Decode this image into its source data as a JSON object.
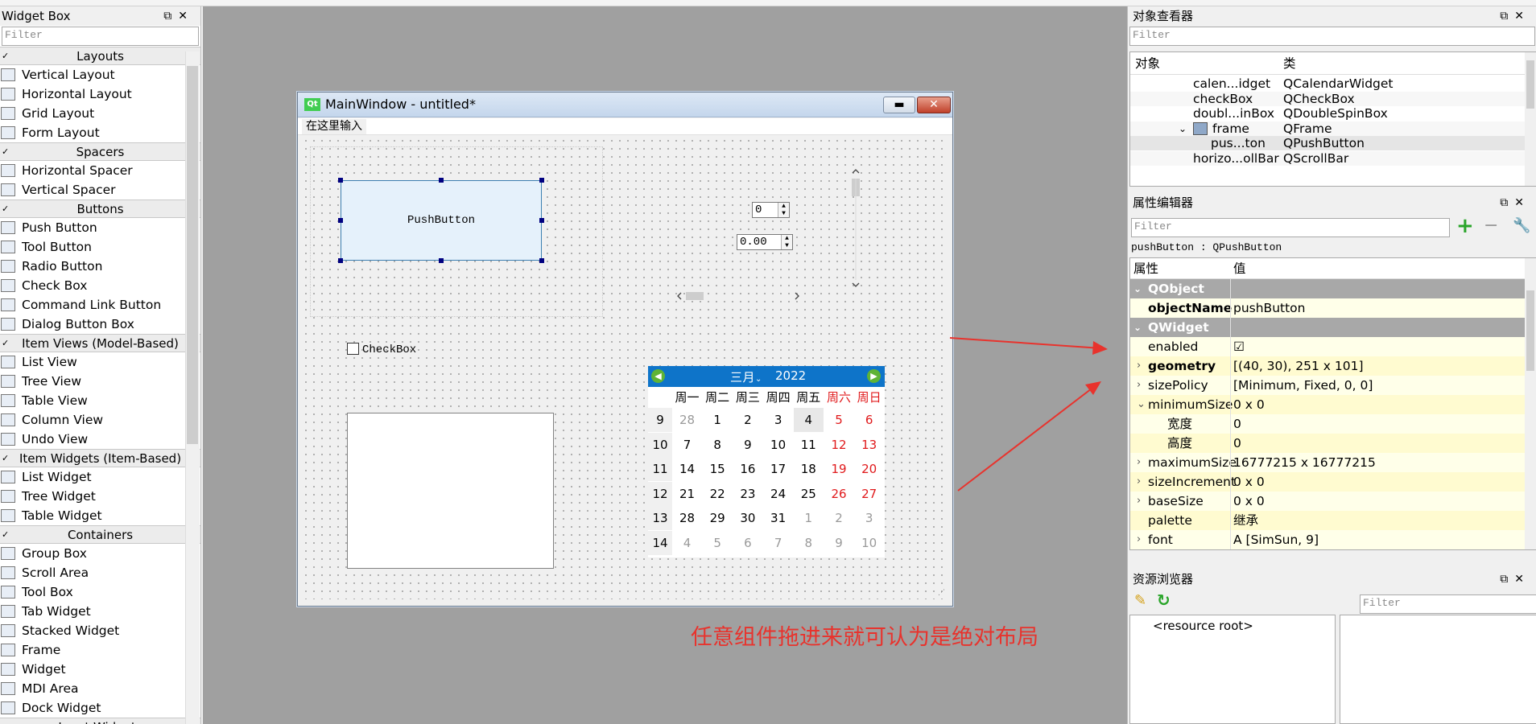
{
  "widget_box": {
    "title": "Widget Box",
    "filter_placeholder": "Filter",
    "categories": [
      {
        "label": "Layouts",
        "items": [
          "Vertical Layout",
          "Horizontal Layout",
          "Grid Layout",
          "Form Layout"
        ]
      },
      {
        "label": "Spacers",
        "items": [
          "Horizontal Spacer",
          "Vertical Spacer"
        ]
      },
      {
        "label": "Buttons",
        "items": [
          "Push Button",
          "Tool Button",
          "Radio Button",
          "Check Box",
          "Command Link Button",
          "Dialog Button Box"
        ]
      },
      {
        "label": "Item Views (Model-Based)",
        "items": [
          "List View",
          "Tree View",
          "Table View",
          "Column View",
          "Undo View"
        ]
      },
      {
        "label": "Item Widgets (Item-Based)",
        "items": [
          "List Widget",
          "Tree Widget",
          "Table Widget"
        ]
      },
      {
        "label": "Containers",
        "items": [
          "Group Box",
          "Scroll Area",
          "Tool Box",
          "Tab Widget",
          "Stacked Widget",
          "Frame",
          "Widget",
          "MDI Area",
          "Dock Widget"
        ]
      }
    ],
    "partial_last": "Input Widgets"
  },
  "main_window": {
    "title": "MainWindow - untitled*",
    "logo": "Qt",
    "menu_placeholder": "在这里输入",
    "push_button_label": "PushButton",
    "checkbox_label": "CheckBox",
    "spin_value": "0",
    "double_spin_value": "0.00"
  },
  "calendar": {
    "month": "三月",
    "year": "2022",
    "weekdays": [
      "周一",
      "周二",
      "周三",
      "周四",
      "周五",
      "周六",
      "周日"
    ],
    "weeks": [
      {
        "wk": "9",
        "days": [
          "28",
          "1",
          "2",
          "3",
          "4",
          "5",
          "6"
        ]
      },
      {
        "wk": "10",
        "days": [
          "7",
          "8",
          "9",
          "10",
          "11",
          "12",
          "13"
        ]
      },
      {
        "wk": "11",
        "days": [
          "14",
          "15",
          "16",
          "17",
          "18",
          "19",
          "20"
        ]
      },
      {
        "wk": "12",
        "days": [
          "21",
          "22",
          "23",
          "24",
          "25",
          "26",
          "27"
        ]
      },
      {
        "wk": "13",
        "days": [
          "28",
          "29",
          "30",
          "31",
          "1",
          "2",
          "3"
        ]
      },
      {
        "wk": "14",
        "days": [
          "4",
          "5",
          "6",
          "7",
          "8",
          "9",
          "10"
        ]
      }
    ],
    "weekend_color": "#e0191b",
    "header_color": "#0e74c9"
  },
  "object_inspector": {
    "title": "对象查看器",
    "filter_placeholder": "Filter",
    "col_object": "对象",
    "col_class": "类",
    "rows": [
      {
        "name": "calen...idget",
        "cls": "QCalendarWidget"
      },
      {
        "name": "checkBox",
        "cls": "QCheckBox"
      },
      {
        "name": "doubl...inBox",
        "cls": "QDoubleSpinBox"
      },
      {
        "name": "frame",
        "cls": "QFrame"
      },
      {
        "name": "pus...ton",
        "cls": "QPushButton"
      },
      {
        "name": "horizo...ollBar",
        "cls": "QScrollBar"
      }
    ]
  },
  "property_editor": {
    "title": "属性编辑器",
    "filter_placeholder": "Filter",
    "object_line": "pushButton : QPushButton",
    "col_prop": "属性",
    "col_value": "值",
    "rows": [
      {
        "kind": "section",
        "name": "QObject"
      },
      {
        "kind": "prop",
        "name": "objectName",
        "value": "pushButton",
        "bold": true
      },
      {
        "kind": "section",
        "name": "QWidget"
      },
      {
        "kind": "prop",
        "name": "enabled",
        "value": "☑"
      },
      {
        "kind": "prop",
        "name": "geometry",
        "value": "[(40, 30), 251 x 101]",
        "bold": true,
        "exp": "›"
      },
      {
        "kind": "prop",
        "name": "sizePolicy",
        "value": "[Minimum, Fixed, 0, 0]",
        "exp": "›"
      },
      {
        "kind": "prop",
        "name": "minimumSize",
        "value": "0 x 0",
        "exp": "⌄"
      },
      {
        "kind": "sub",
        "name": "宽度",
        "value": "0"
      },
      {
        "kind": "sub",
        "name": "高度",
        "value": "0"
      },
      {
        "kind": "prop",
        "name": "maximumSize",
        "value": "16777215 x 16777215",
        "exp": "›"
      },
      {
        "kind": "prop",
        "name": "sizeIncrement",
        "value": "0 x 0",
        "exp": "›"
      },
      {
        "kind": "prop",
        "name": "baseSize",
        "value": "0 x 0",
        "exp": "›"
      },
      {
        "kind": "prop",
        "name": "palette",
        "value": "继承"
      },
      {
        "kind": "prop",
        "name": "font",
        "value": "A  [SimSun, 9]",
        "exp": "›"
      }
    ]
  },
  "resource_browser": {
    "title": "资源浏览器",
    "filter_placeholder": "Filter",
    "root": "<resource root>"
  },
  "annotation": "任意组件拖进来就可认为是绝对布局",
  "annotation_color": "#e8332d"
}
